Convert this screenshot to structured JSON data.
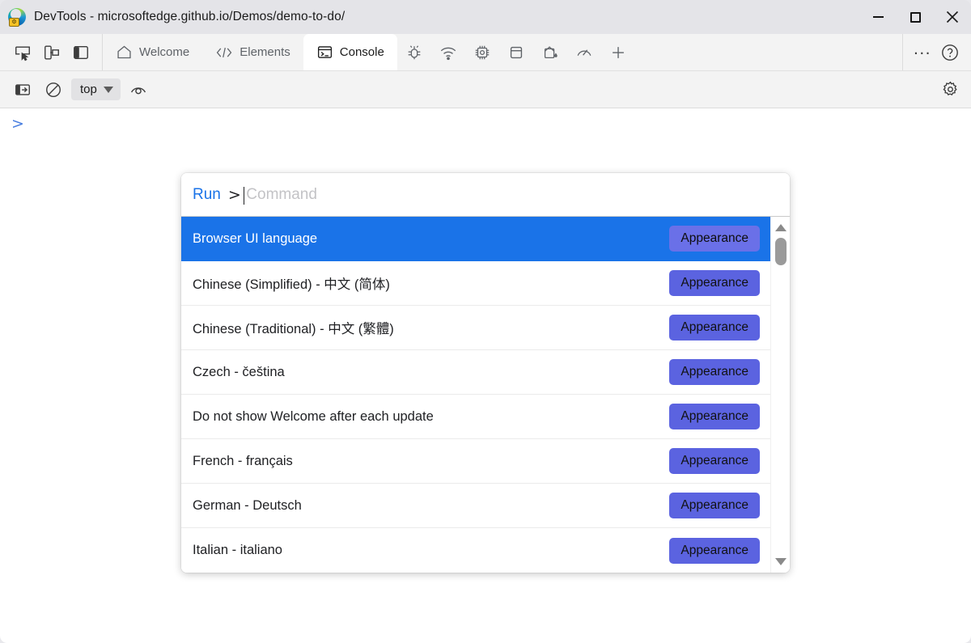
{
  "window": {
    "title": "DevTools - microsoftedge.github.io/Demos/demo-to-do/",
    "app_icon": "edge-devtools-icon",
    "controls": {
      "minimize": "minimize-icon",
      "maximize": "maximize-icon",
      "close": "close-icon"
    }
  },
  "tabstrip": {
    "left_tools": [
      {
        "name": "inspect-element-icon",
        "title": "Inspect"
      },
      {
        "name": "device-emulation-icon",
        "title": "Toggle device emulation"
      },
      {
        "name": "dock-side-icon",
        "title": "Dock side"
      }
    ],
    "tabs": [
      {
        "label": "Welcome",
        "icon": "home-icon",
        "active": false
      },
      {
        "label": "Elements",
        "icon": "code-brackets-icon",
        "active": false
      },
      {
        "label": "Console",
        "icon": "console-terminal-icon",
        "active": true
      },
      {
        "label": "",
        "icon": "bug-icon",
        "active": false
      },
      {
        "label": "",
        "icon": "network-wifi-icon",
        "active": false
      },
      {
        "label": "",
        "icon": "memory-chip-icon",
        "active": false
      },
      {
        "label": "",
        "icon": "application-storage-icon",
        "active": false
      },
      {
        "label": "",
        "icon": "paint-bucket-icon",
        "active": false
      },
      {
        "label": "",
        "icon": "performance-gauge-icon",
        "active": false
      },
      {
        "label": "",
        "icon": "plus-icon",
        "active": false
      }
    ],
    "right_tools": [
      {
        "name": "more-tools-icon",
        "label": "..."
      },
      {
        "name": "help-question-icon",
        "label": "?"
      }
    ]
  },
  "console_toolbar": {
    "sidebar_toggle": "console-sidebar-icon",
    "clear_console": "clear-console-icon",
    "context_selector": {
      "value": "top",
      "chevron": "chevron-down-icon"
    },
    "live_expression": "eye-icon",
    "settings": "gear-icon"
  },
  "console": {
    "prompt_chevron": ">"
  },
  "palette": {
    "run_chip_label": "Run",
    "prefix": ">",
    "placeholder": "Command",
    "input_value": "",
    "selected_index": 0,
    "items": [
      {
        "label": "Browser UI language",
        "tag": "Appearance"
      },
      {
        "label": "Chinese (Simplified) - 中文 (简体)",
        "tag": "Appearance"
      },
      {
        "label": "Chinese (Traditional) - 中文 (繁體)",
        "tag": "Appearance"
      },
      {
        "label": "Czech - čeština",
        "tag": "Appearance"
      },
      {
        "label": "Do not show Welcome after each update",
        "tag": "Appearance"
      },
      {
        "label": "French - français",
        "tag": "Appearance"
      },
      {
        "label": "German - Deutsch",
        "tag": "Appearance"
      },
      {
        "label": "Italian - italiano",
        "tag": "Appearance"
      }
    ],
    "scrollbar": {
      "up": "scroll-up-arrow-icon",
      "down": "scroll-down-arrow-icon"
    }
  },
  "colors": {
    "selection_blue": "#1a73e8",
    "tag_purple": "#5b63e0",
    "accent_link": "#1a73e8",
    "titlebar_bg": "#e4e4e8",
    "toolbar_bg": "#f3f3f3"
  }
}
